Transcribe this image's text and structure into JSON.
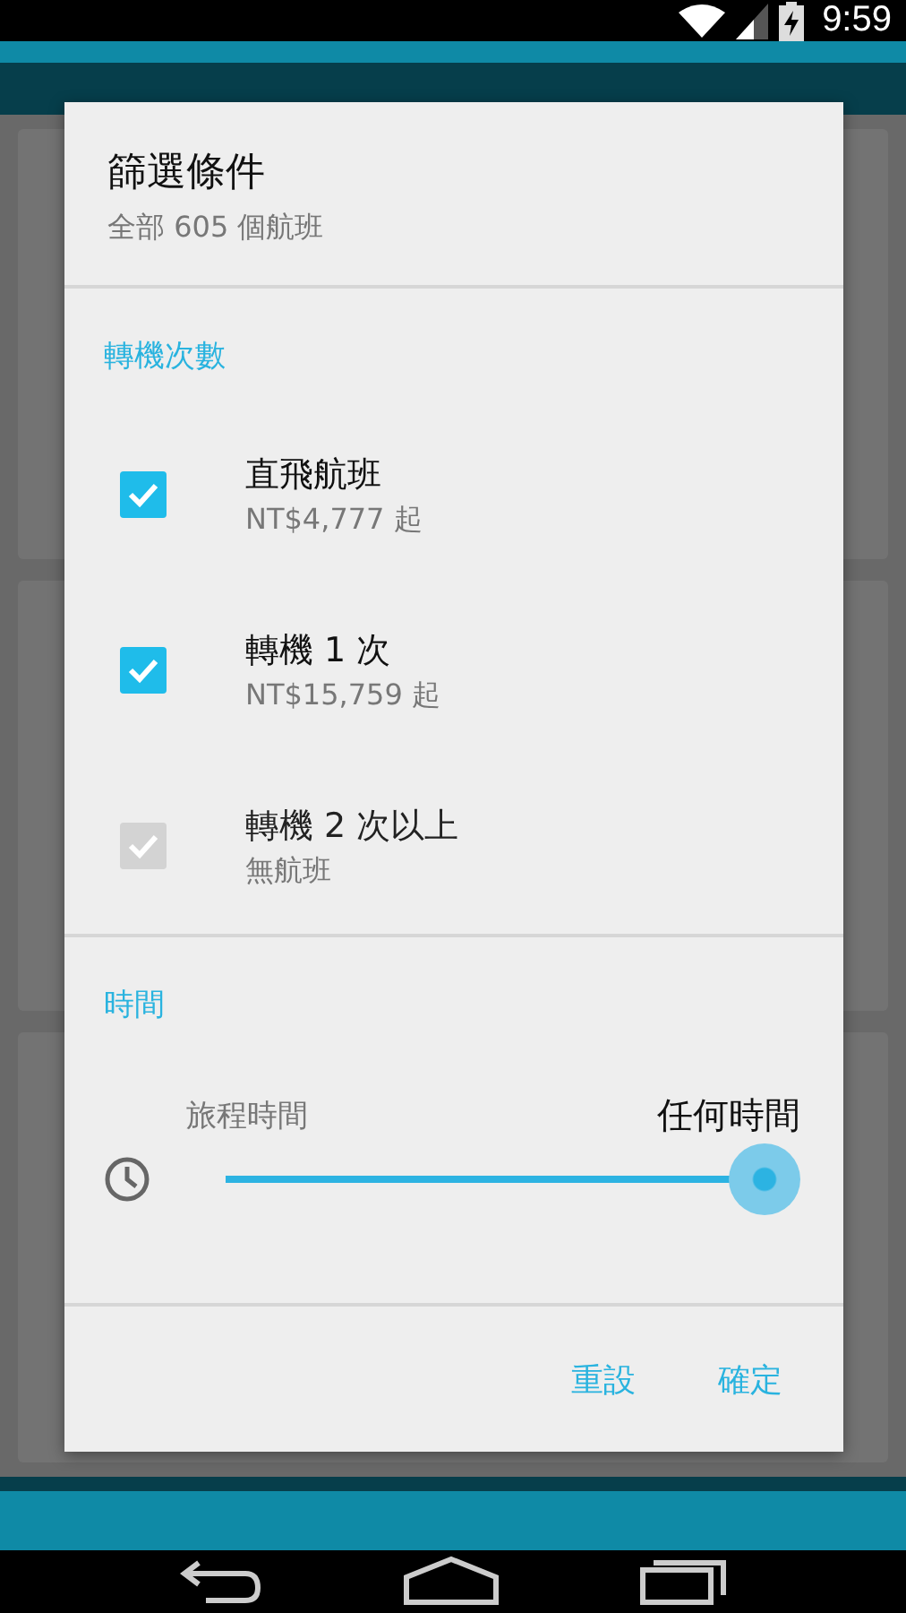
{
  "status_bar": {
    "time": "9:59"
  },
  "dialog": {
    "title": "篩選條件",
    "subtitle": "全部 605 個航班",
    "sections": [
      {
        "kind": "checkboxes",
        "header": "轉機次數",
        "items": [
          {
            "label": "直飛航班",
            "detail": "NT$4,777 起",
            "checked": true,
            "disabled": false
          },
          {
            "label": "轉機 1 次",
            "detail": "NT$15,759 起",
            "checked": true,
            "disabled": false
          },
          {
            "label": "轉機 2 次以上",
            "detail": "無航班",
            "checked": true,
            "disabled": true
          }
        ]
      },
      {
        "kind": "slider",
        "header": "時間",
        "label": "旅程時間",
        "value": "任何時間",
        "level": 1
      }
    ],
    "buttons": [
      "重設",
      "確定"
    ]
  }
}
